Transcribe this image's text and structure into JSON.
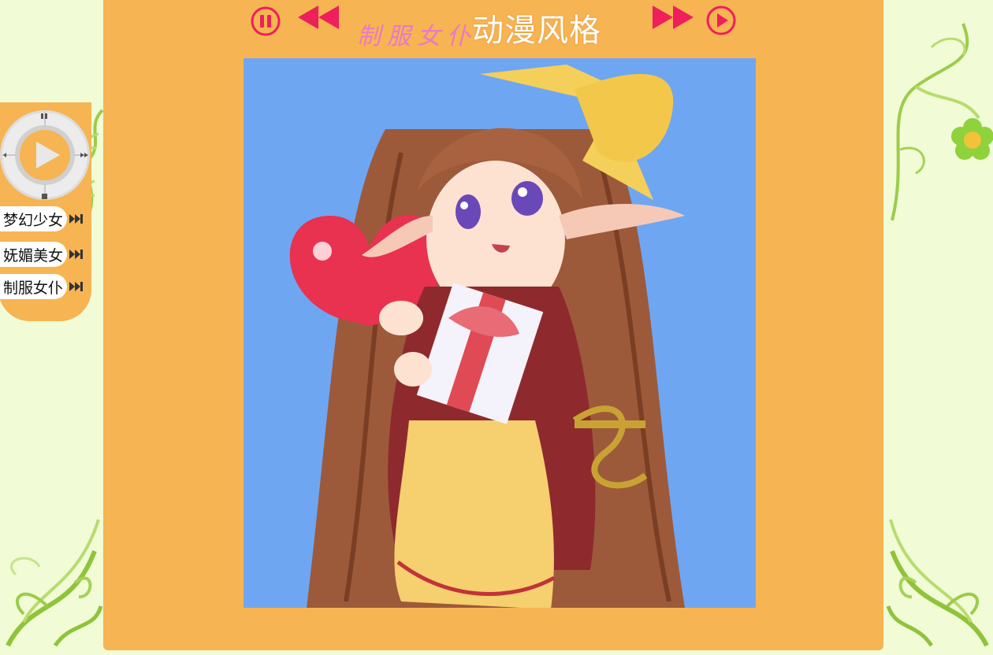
{
  "header": {
    "category_title": "制服女仆",
    "style_title": "动漫风格",
    "pause_icon": "pause-circle-icon",
    "prev_icon": "rewind-icon",
    "next_icon": "fast-forward-icon",
    "play_icon": "play-circle-icon"
  },
  "sidebar": {
    "player_icon": "play-disc-icon",
    "items": [
      {
        "label": "梦幻少女",
        "icon": "skip-next-icon"
      },
      {
        "label": "妩媚美女",
        "icon": "skip-next-icon"
      },
      {
        "label": "制服女仆",
        "icon": "skip-next-icon"
      }
    ]
  },
  "gallery": {
    "image_subject": "anime maid girl holding gift box",
    "image_icon": "artwork-image"
  },
  "colors": {
    "background": "#f1fbd6",
    "panel": "#f7b452",
    "accent": "#ee1f5c",
    "image_bg": "#6fa6f2"
  }
}
